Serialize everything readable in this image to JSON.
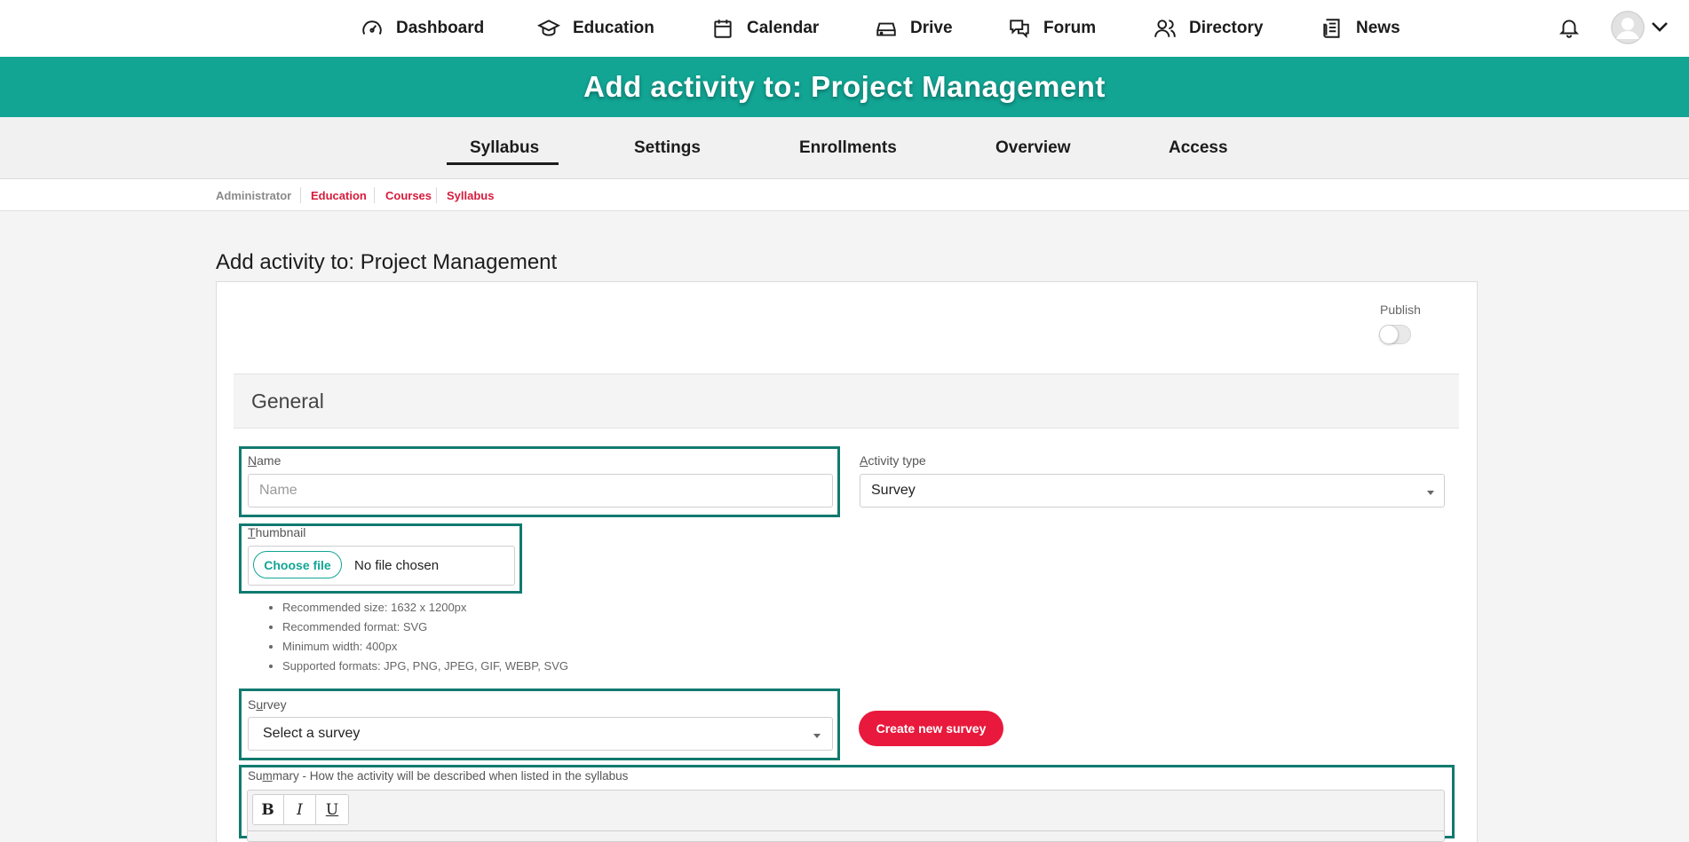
{
  "topnav": {
    "items": [
      {
        "label": "Dashboard",
        "icon": "gauge-icon"
      },
      {
        "label": "Education",
        "icon": "graduation-cap-icon"
      },
      {
        "label": "Calendar",
        "icon": "calendar-icon"
      },
      {
        "label": "Drive",
        "icon": "drive-icon"
      },
      {
        "label": "Forum",
        "icon": "chat-bubbles-icon"
      },
      {
        "label": "Directory",
        "icon": "users-icon"
      },
      {
        "label": "News",
        "icon": "newspaper-icon"
      }
    ],
    "notifications_icon": "bell-icon",
    "avatar_icon": "user-avatar-icon"
  },
  "banner": {
    "title": "Add activity to: Project Management"
  },
  "subtabs": [
    {
      "label": "Syllabus",
      "active": true
    },
    {
      "label": "Settings"
    },
    {
      "label": "Enrollments"
    },
    {
      "label": "Overview"
    },
    {
      "label": "Access"
    }
  ],
  "breadcrumb": [
    "Administrator",
    "Education",
    "Courses",
    "Syllabus"
  ],
  "page": {
    "title": "Add activity to: Project Management"
  },
  "publish": {
    "label": "Publish",
    "enabled": false
  },
  "section": {
    "title": "General"
  },
  "form": {
    "name": {
      "label_first": "N",
      "label_rest": "ame",
      "placeholder": "Name",
      "value": ""
    },
    "activity_type": {
      "label_first": "A",
      "label_rest": "ctivity type",
      "value": "Survey"
    },
    "thumbnail": {
      "label_first": "T",
      "label_rest": "humbnail",
      "button": "Choose file",
      "status": "No file chosen",
      "hints": [
        "Recommended size: 1632 x 1200px",
        "Recommended format: SVG",
        "Minimum width: 400px",
        "Supported formats: JPG, PNG, JPEG, GIF, WEBP, SVG"
      ]
    },
    "survey": {
      "label_first": "S",
      "label_key": "u",
      "label_rest": "rvey",
      "value": "Select a survey",
      "create_button": "Create new survey"
    },
    "summary": {
      "label_first": "Su",
      "label_key": "m",
      "label_rest": "mary - How the activity will be described when listed in the syllabus",
      "toolbar": [
        "B",
        "I",
        "U"
      ]
    }
  },
  "colors": {
    "brand": "#12a594",
    "accent": "#e8193c",
    "highlight": "#117a6f"
  }
}
